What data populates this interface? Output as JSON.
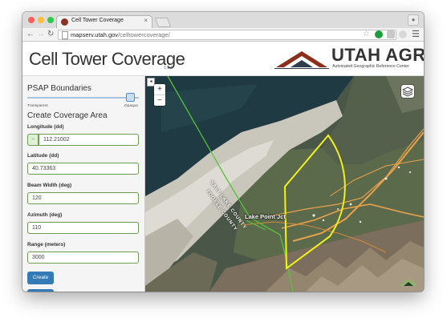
{
  "browser": {
    "tab_title": "Cell Tower Coverage",
    "tab_close": "×",
    "url_host": "mapserv.utah.gov",
    "url_path": "/celltowercoverage/"
  },
  "header": {
    "title": "Cell Tower Coverage",
    "version": "1.1.1",
    "brand": "UTAH AGRC",
    "brand_subtitle": "Automated Geographic Reference Center"
  },
  "sidebar": {
    "psap_title": "PSAP Boundaries",
    "slider_min_label": "Transparent",
    "slider_max_label": "Opaque",
    "opacity_level": 0.93,
    "coverage_title": "Create Coverage Area",
    "fields": {
      "longitude": {
        "label": "Longitude (dd)",
        "prefix": "−",
        "value": "112.21002"
      },
      "latitude": {
        "label": "Latitude (dd)",
        "value": "40.73363"
      },
      "beam_width": {
        "label": "Beam Width (deg)",
        "value": "120"
      },
      "azimuth": {
        "label": "Azimuth (deg)",
        "value": "110"
      },
      "range": {
        "label": "Range (meters)",
        "value": "3000"
      }
    },
    "create_button": "Create"
  },
  "map": {
    "zoom_in": "+",
    "zoom_out": "−",
    "collapse": "◂",
    "place_label": "Lake Point Jct",
    "county_label_1": "SALT LAKE COUNTY",
    "county_label_2": "TOOELE COUNTY",
    "colors": {
      "coverage": "#f2f21a",
      "boundary": "#55c43a",
      "roads": "#e8a24a"
    }
  }
}
